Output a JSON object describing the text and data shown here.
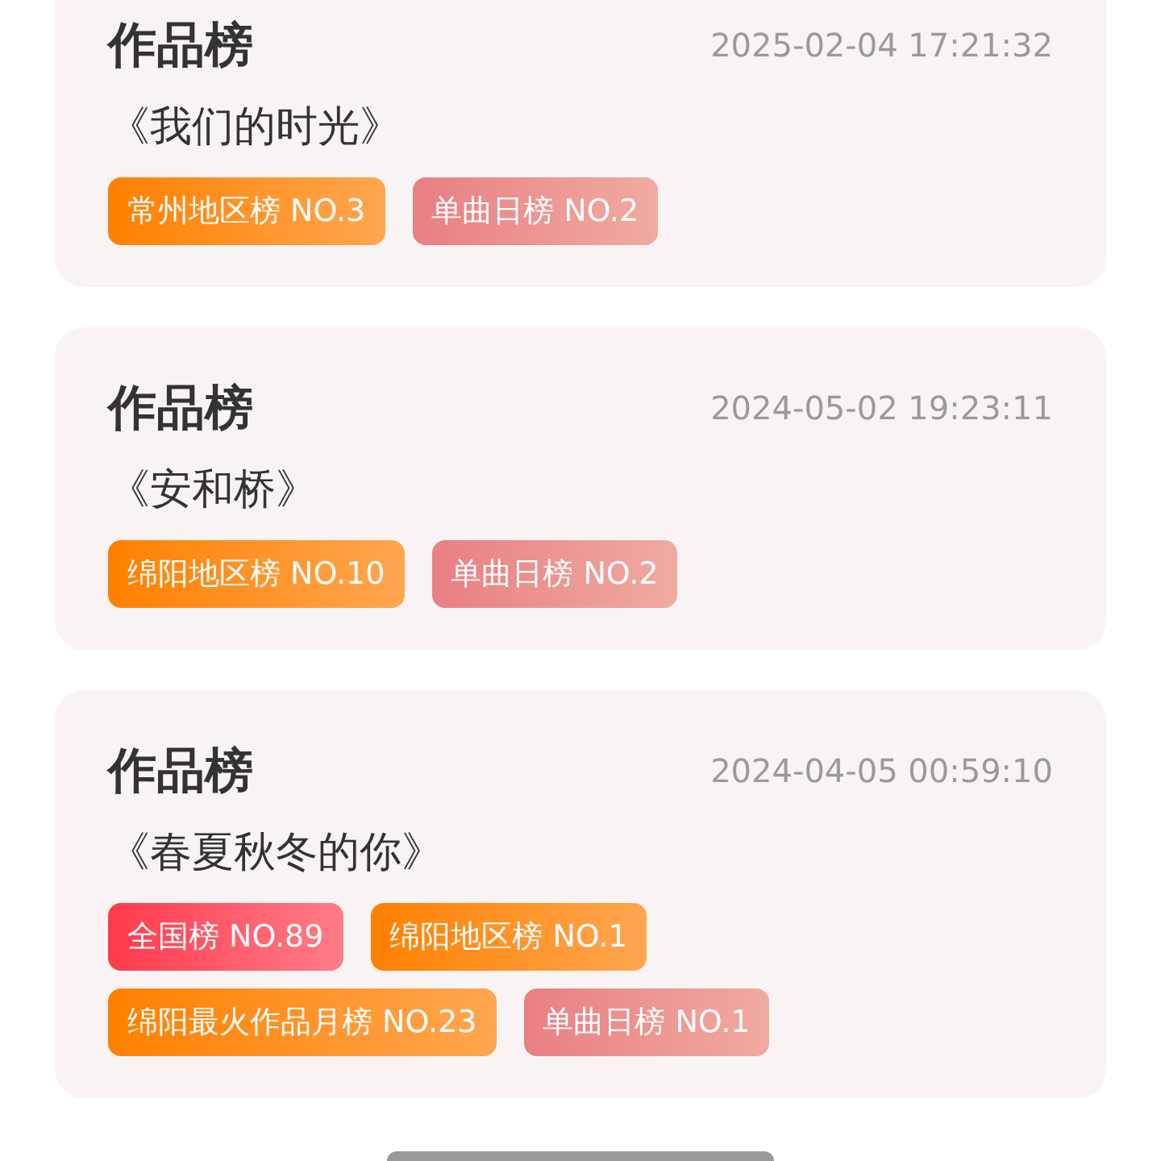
{
  "cards": [
    {
      "title": "作品榜",
      "time": "2025-02-04 17:21:32",
      "song": "《我们的时光》",
      "tags": [
        {
          "kind": "regional",
          "label": "常州地区榜 NO.3"
        },
        {
          "kind": "song",
          "label": "单曲日榜 NO.2"
        }
      ]
    },
    {
      "title": "作品榜",
      "time": "2024-05-02 19:23:11",
      "song": "《安和桥》",
      "tags": [
        {
          "kind": "regional",
          "label": "绵阳地区榜 NO.10"
        },
        {
          "kind": "song",
          "label": "单曲日榜 NO.2"
        }
      ]
    },
    {
      "title": "作品榜",
      "time": "2024-04-05 00:59:10",
      "song": "《春夏秋冬的你》",
      "tags": [
        {
          "kind": "national",
          "label": "全国榜 NO.89"
        },
        {
          "kind": "regional",
          "label": "绵阳地区榜 NO.1"
        },
        {
          "kind": "regional",
          "label": "绵阳最火作品月榜 NO.23"
        },
        {
          "kind": "song",
          "label": "单曲日榜 NO.1"
        }
      ]
    }
  ]
}
